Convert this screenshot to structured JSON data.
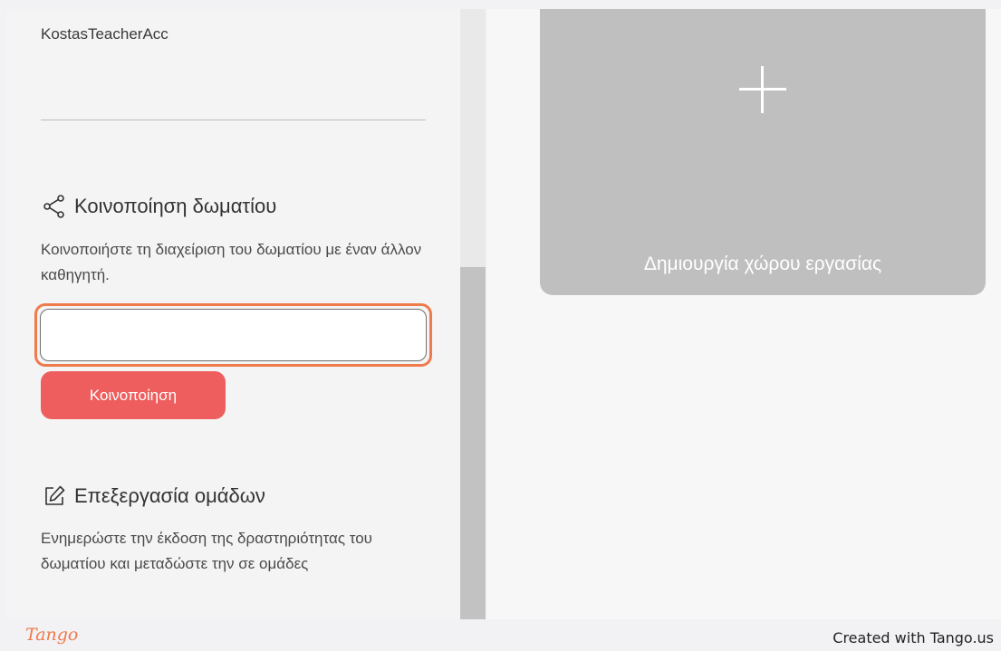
{
  "account": {
    "name": "KostasTeacherAcc"
  },
  "share_section": {
    "title": "Κοινοποίηση δωματίου",
    "description": "Κοινοποιήστε τη διαχείριση του δωματίου με έναν άλλον καθηγητή.",
    "input_value": "",
    "button_label": "Κοινοποίηση",
    "icon": "share-icon"
  },
  "edit_section": {
    "title": "Επεξεργασία ομάδων",
    "description": "Ενημερώστε την έκδοση της δραστηριότητας του δωματίου και μεταδώστε την σε ομάδες",
    "icon": "edit-icon"
  },
  "workspace": {
    "create_label": "Δημιουργία χώρου εργασίας",
    "icon": "plus-icon"
  },
  "footer": {
    "logo": "Tango",
    "credit": "Created with Tango.us"
  },
  "colors": {
    "accent_orange": "#ef7a4c",
    "button_red": "#ee5e5e",
    "card_gray": "#bfbfbf"
  }
}
